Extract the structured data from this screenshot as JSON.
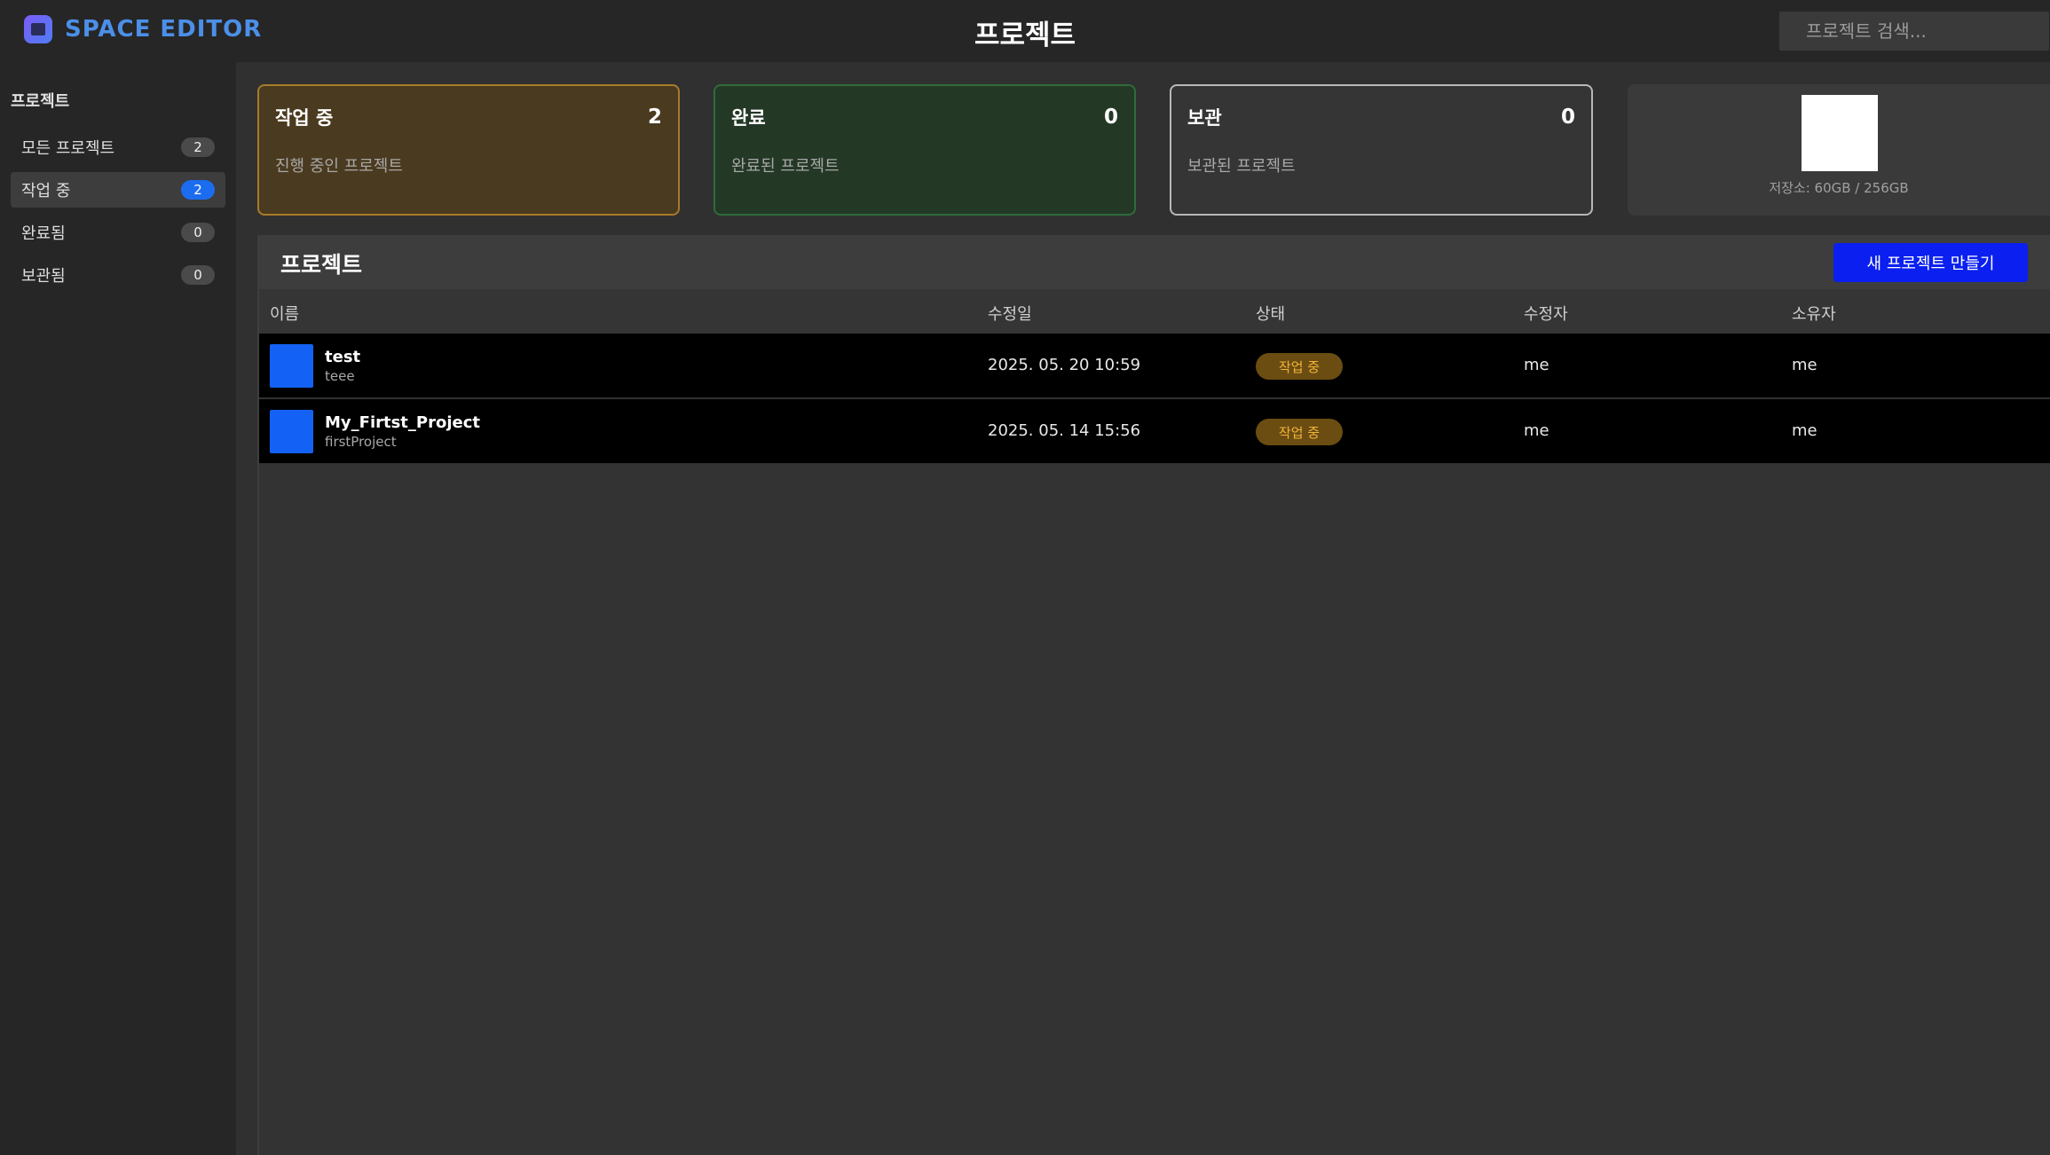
{
  "header": {
    "brand": "SPACE EDITOR",
    "title": "프로젝트",
    "search_placeholder": "프로젝트 검색..."
  },
  "sidebar": {
    "title": "프로젝트",
    "items": [
      {
        "label": "모든 프로젝트",
        "count": "2"
      },
      {
        "label": "작업 중",
        "count": "2"
      },
      {
        "label": "완료됨",
        "count": "0"
      },
      {
        "label": "보관됨",
        "count": "0"
      }
    ]
  },
  "cards": {
    "working": {
      "title": "작업 중",
      "count": "2",
      "desc": "진행 중인 프로젝트"
    },
    "done": {
      "title": "완료",
      "count": "0",
      "desc": "완료된 프로젝트"
    },
    "archive": {
      "title": "보관",
      "count": "0",
      "desc": "보관된 프로젝트"
    },
    "storage": {
      "text": "저장소: 60GB / 256GB"
    }
  },
  "projects": {
    "title": "프로젝트",
    "new_button": "새 프로젝트 만들기",
    "columns": [
      "이름",
      "수정일",
      "상태",
      "수정자",
      "소유자"
    ],
    "rows": [
      {
        "name": "test",
        "sub": "teee",
        "modified": "2025. 05. 20 10:59",
        "status": "작업 중",
        "editor": "me",
        "owner": "me"
      },
      {
        "name": "My_Firtst_Project",
        "sub": "firstProject",
        "modified": "2025. 05. 14 15:56",
        "status": "작업 중",
        "editor": "me",
        "owner": "me"
      }
    ]
  },
  "colors": {
    "accent": "#1c6cf0",
    "brand": "#4c8fe8",
    "new_button": "#0a1ff0",
    "status_working": "#f0b23a"
  }
}
